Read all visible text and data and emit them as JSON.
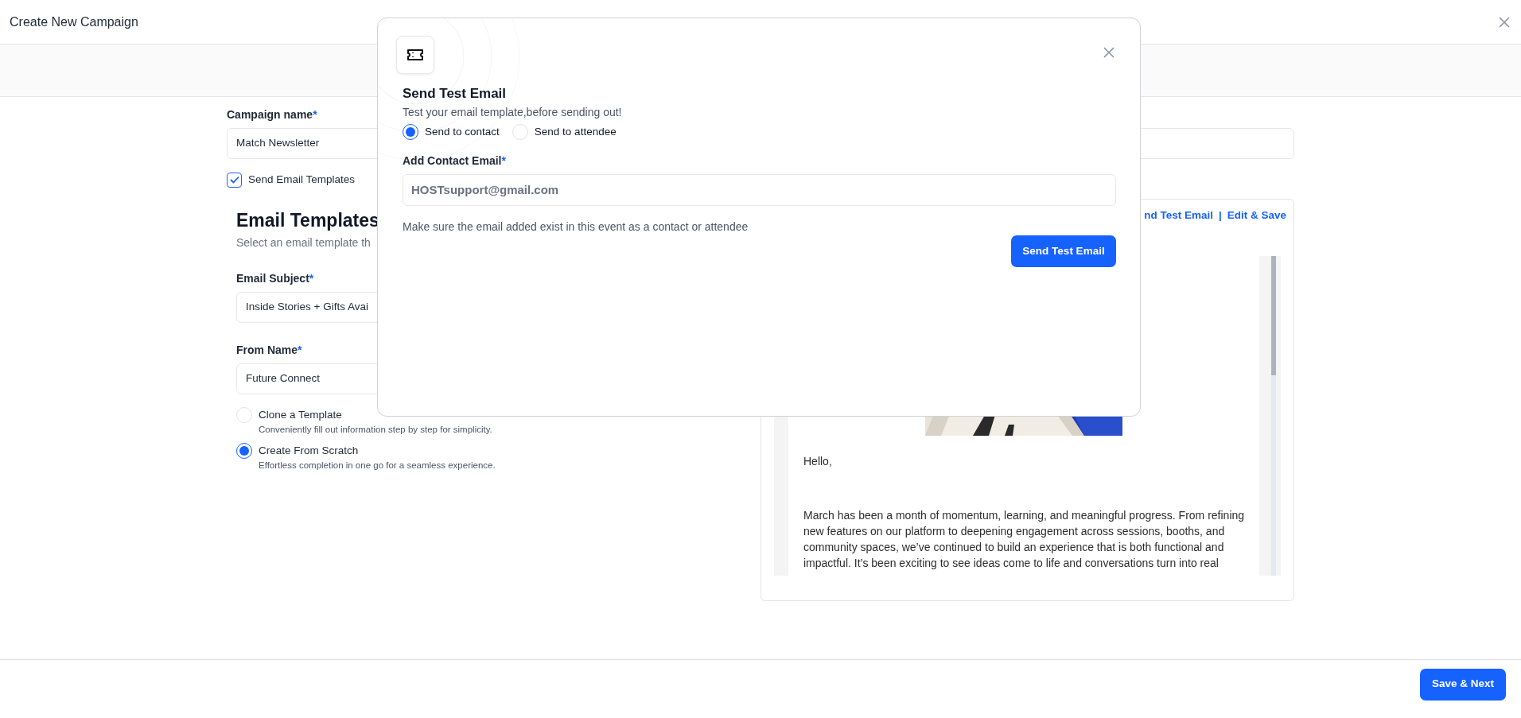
{
  "page": {
    "title": "Create New Campaign"
  },
  "campaign_name": {
    "label": "Campaign name",
    "required": "*",
    "value": "Match Newsletter"
  },
  "send_email_templates": {
    "label": "Send Email Templates",
    "checked": true
  },
  "email_templates": {
    "heading": "Email Templates",
    "subtitle": "Select an email template th",
    "fields": [
      {
        "label": "Email Subject",
        "required": "*",
        "value": "Inside Stories + Gifts Avai"
      },
      {
        "label": "From Name",
        "required": "*",
        "value": "Future Connect"
      }
    ],
    "options": [
      {
        "label": "Clone a Template",
        "description": "Conveniently fill out information step by step for simplicity.",
        "selected": false
      },
      {
        "label": "Create From Scratch",
        "description": "Effortless completion in one go for a seamless experience.",
        "selected": true
      }
    ]
  },
  "preview": {
    "links": [
      "nd Test Email",
      "Edit & Save"
    ],
    "separator": "|",
    "greeting": "Hello,",
    "body": [
      "March has been a month of momentum, learning, and meaningful progress. From refining",
      "new features on our platform to deepening engagement across sessions, booths, and",
      "community spaces, we’ve continued to build an experience that is both functional and",
      "impactful. It’s been exciting to see ideas come to life and conversations turn into real"
    ]
  },
  "footer": {
    "button": "Save & Next"
  },
  "dialog": {
    "title": "Send Test Email",
    "subtitle": "Test your email template,before sending out!",
    "recipients": [
      {
        "label": "Send to contact",
        "selected": true
      },
      {
        "label": "Send to attendee",
        "selected": false
      }
    ],
    "email_label": "Add Contact Email",
    "required": "*",
    "email_placeholder": "HOSTsupport@gmail.com",
    "note": "Make sure the email added exist in this event as a contact or attendee",
    "button": "Send Test Email"
  }
}
